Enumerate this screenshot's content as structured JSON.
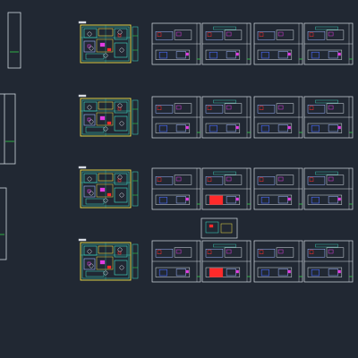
{
  "app": {
    "view": "cad-model-space",
    "background": "#212833"
  },
  "colors": {
    "sheet_border": "#d8dde4",
    "floor_plan": "#3ee0c8",
    "wall_yellow": "#f2e24a",
    "accent_magenta": "#e23ce2",
    "accent_red": "#ff2a2a",
    "accent_blue": "#4a6cff",
    "accent_green": "#34d04b",
    "furniture": "#9fb6ff"
  },
  "layout_sets": [
    {
      "row": 1,
      "floor_plan_icon": "floor-plan",
      "elevation_sheets": 4,
      "highlighted_sheet": "none"
    },
    {
      "row": 2,
      "floor_plan_icon": "floor-plan",
      "elevation_sheets": 4,
      "highlighted_sheet": "none"
    },
    {
      "row": 3,
      "floor_plan_icon": "floor-plan",
      "elevation_sheets": 4,
      "highlighted_sheet": "red-block-sheet-2"
    },
    {
      "row": 4,
      "floor_plan_icon": "floor-plan",
      "elevation_sheets": 4,
      "highlighted_sheet": "red-block-sheet-2"
    }
  ]
}
